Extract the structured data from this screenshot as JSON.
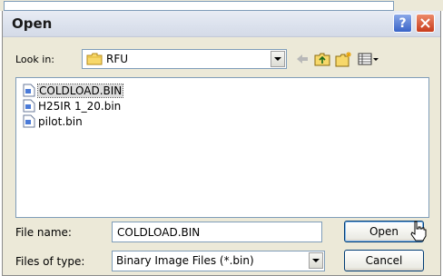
{
  "window": {
    "title": "Open"
  },
  "look_in": {
    "label": "Look in:",
    "value": "RFU"
  },
  "files": [
    {
      "name": "COLDLOAD.BIN",
      "selected": true
    },
    {
      "name": "H25IR 1_20.bin",
      "selected": false
    },
    {
      "name": "pilot.bin",
      "selected": false
    }
  ],
  "file_name": {
    "label": "File name:",
    "value": "COLDLOAD.BIN"
  },
  "file_type": {
    "label": "Files of type:",
    "value": "Binary Image Files (*.bin)"
  },
  "buttons": {
    "open": "Open",
    "cancel": "Cancel",
    "help": "?"
  }
}
